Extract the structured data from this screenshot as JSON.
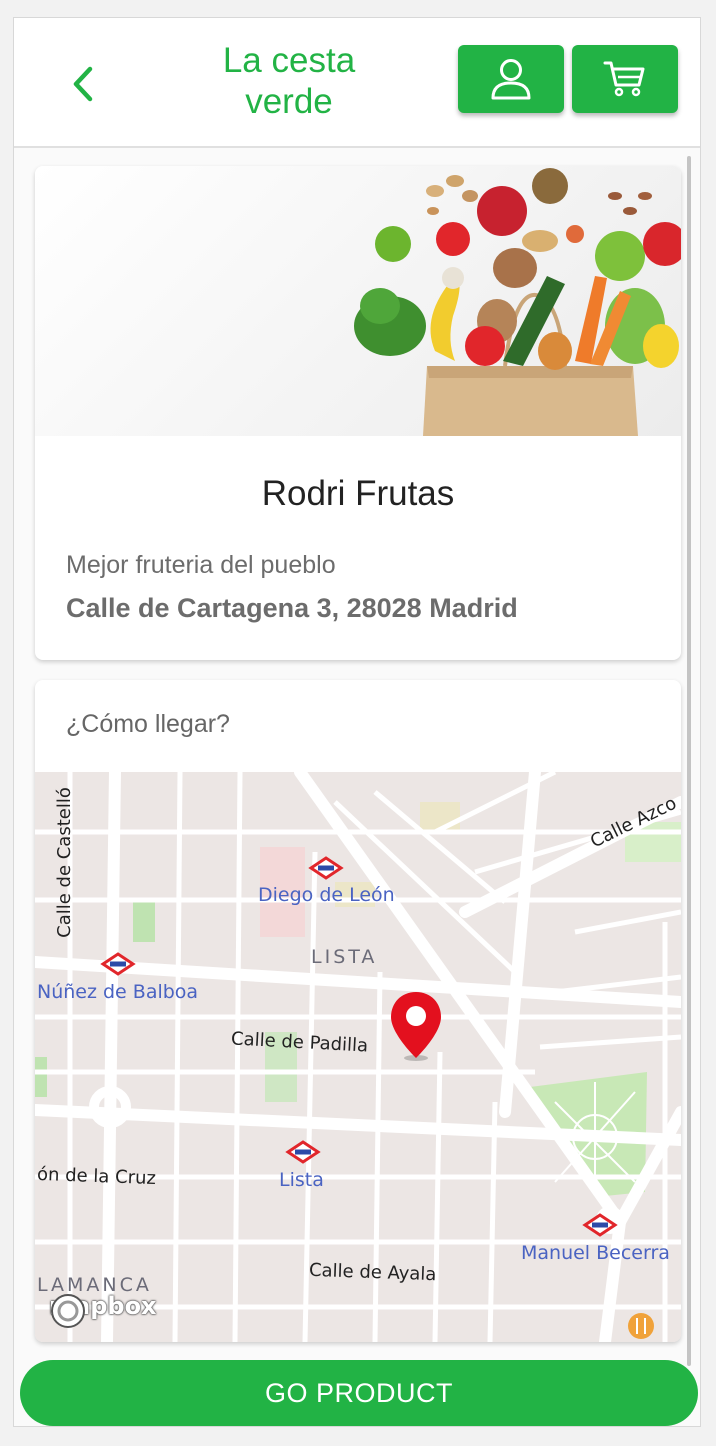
{
  "app": {
    "title": "La cesta verde"
  },
  "header": {
    "back_icon": "chevron-left-icon",
    "user_icon": "user-icon",
    "cart_icon": "cart-icon",
    "accent": "#22b345"
  },
  "shop": {
    "image": "grocery-bag-vegetables",
    "name": "Rodri Frutas",
    "description": "Mejor fruteria del pueblo",
    "address": "Calle de Cartagena 3, 28028 Madrid"
  },
  "map": {
    "heading": "¿Cómo llegar?",
    "attribution": "mapbox",
    "marker_icon": "map-pin-icon",
    "labels": {
      "calle_castello": "Calle de Castelló",
      "calle_azcona": "Calle Azco",
      "diego_de_leon": "Diego de León",
      "lista_area": "LISTA",
      "nunez_de_balboa": "Núñez de Balboa",
      "calle_padilla": "Calle de Padilla",
      "lista_metro": "Lista",
      "cruz": "ón de la Cruz",
      "manuel_becerra": "Manuel Becerra",
      "calle_ayala": "Calle de Ayala",
      "salamanca": "LAMANCA"
    }
  },
  "footer": {
    "go_label": "GO PRODUCT"
  }
}
